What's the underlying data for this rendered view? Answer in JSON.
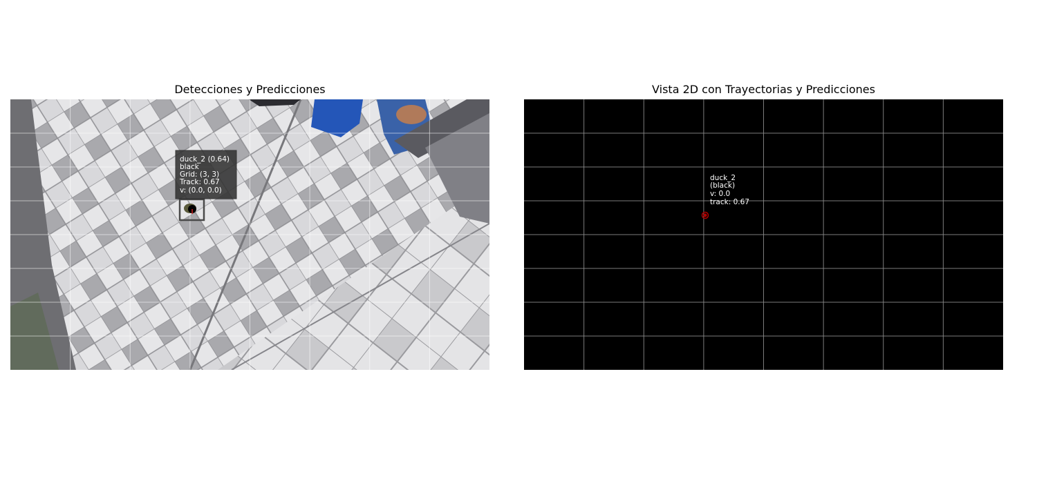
{
  "left_panel": {
    "title": "Detecciones y Predicciones",
    "detection": {
      "label_lines": [
        "duck_2 (0.64)",
        "black",
        "Grid: (3, 3)",
        "Track: 0.67",
        "v: (0.0, 0.0)"
      ]
    }
  },
  "right_panel": {
    "title": "Vista 2D con Trayectorias y Predicciones",
    "track": {
      "label_lines": [
        "duck_2",
        "(black)",
        "v: 0.0",
        "track: 0.67"
      ],
      "marker_color": "#b00000"
    }
  },
  "grid": {
    "columns": 8,
    "rows": 8
  },
  "colors": {
    "grid_line_left": "#ffffff",
    "grid_line_right": "#8a8a8a",
    "label_bg": "#333333",
    "label_text": "#ffffff",
    "bbox": "#4a4a4a",
    "center_dot": "#000000"
  }
}
